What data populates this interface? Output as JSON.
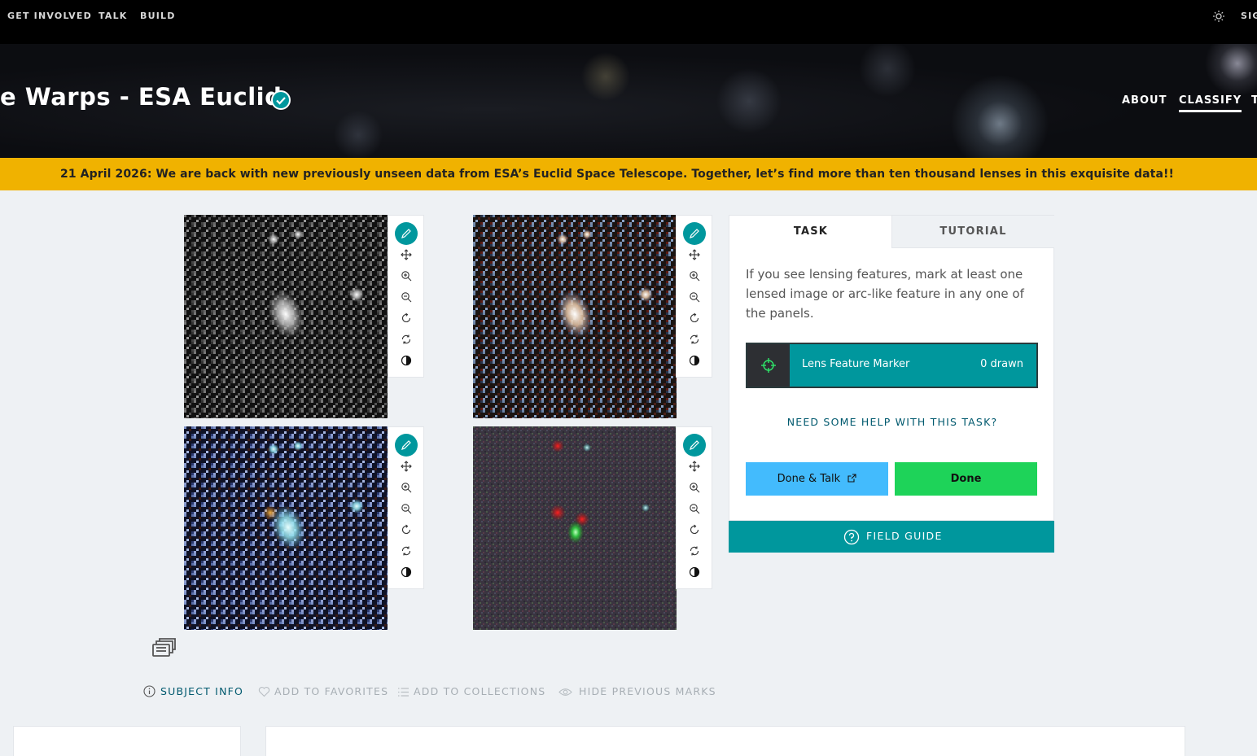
{
  "topnav": {
    "links": [
      "GET INVOLVED",
      "TALK",
      "BUILD"
    ],
    "sign_in": "SIG",
    "theme_icon": "sun-icon"
  },
  "project": {
    "title": "e Warps - ESA Euclid",
    "verified_icon": "check-badge-icon",
    "nav": [
      "ABOUT",
      "CLASSIFY",
      "T"
    ],
    "active_nav": "CLASSIFY"
  },
  "banner": {
    "text": "21 April 2026: We are back with new previously unseen data from ESA’s Euclid Space Telescope. Together, let’s find more than ten thousand lenses in this exquisite data!!",
    "color": "#f0b200"
  },
  "image_toolbar": {
    "tools": [
      "pencil-icon",
      "move-icon",
      "zoom-in-icon",
      "zoom-out-icon",
      "rotate-icon",
      "reset-icon",
      "invert-icon"
    ]
  },
  "task_panel": {
    "tabs": [
      "TASK",
      "TUTORIAL"
    ],
    "active_tab": "TASK",
    "instruction": "If you see lensing features, mark at least one lensed image or arc-like feature in any one of the panels.",
    "marker": {
      "label": "Lens Feature Marker",
      "count": "0 drawn",
      "icon": "crosshair-icon"
    },
    "help": "NEED SOME HELP WITH THIS TASK?",
    "done_talk": "Done & Talk",
    "done": "Done",
    "field_guide": "FIELD GUIDE"
  },
  "subject_actions": {
    "info": "SUBJECT INFO",
    "favorites": "ADD TO FAVORITES",
    "collections": "ADD TO COLLECTIONS",
    "hide_marks": "HIDE PREVIOUS MARKS"
  },
  "colors": {
    "teal": "#00979d",
    "talk_blue": "#43bbfd",
    "done_green": "#1ed359",
    "link_dark_teal": "#00596e"
  }
}
